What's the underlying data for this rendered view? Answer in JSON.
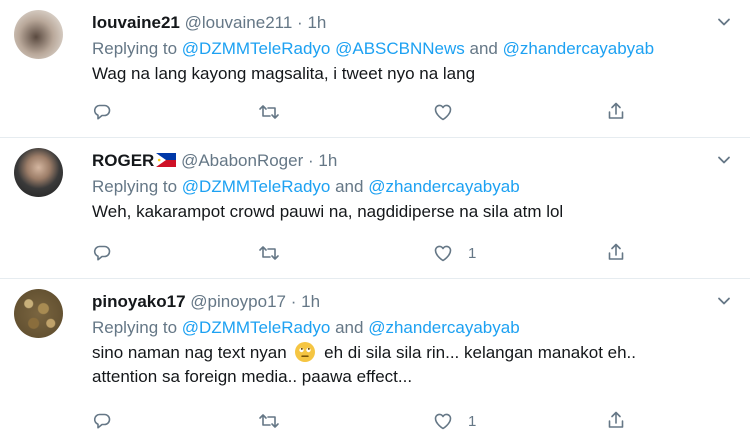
{
  "tweets": [
    {
      "name": "louvaine21",
      "handle": "@louvaine211",
      "dot": "·",
      "time": "1h",
      "replying_prefix": "Replying to ",
      "mentions": [
        "@DZMMTeleRadyo",
        "@ABSCBNNews",
        "@zhandercayabyab"
      ],
      "and": "and",
      "text_lines": [
        "Wag na lang kayong magsalita, i tweet nyo na lang"
      ],
      "like_count": ""
    },
    {
      "name": "ROGER",
      "handle": "@AbabonRoger",
      "dot": "·",
      "time": "1h",
      "replying_prefix": "Replying to ",
      "mentions": [
        "@DZMMTeleRadyo",
        "@zhandercayabyab"
      ],
      "and": "and",
      "text_lines": [
        "Weh, kakarampot crowd pauwi na, nagdidiperse na sila atm lol"
      ],
      "like_count": "1"
    },
    {
      "name": "pinoyako17",
      "handle": "@pinoypo17",
      "dot": "·",
      "time": "1h",
      "replying_prefix": "Replying to ",
      "mentions": [
        "@DZMMTeleRadyo",
        "@zhandercayabyab"
      ],
      "and": "and",
      "text_lines": [
        "sino naman nag text nyan",
        "eh di sila sila rin... kelangan manakot eh..",
        "attention sa foreign media.. paawa effect..."
      ],
      "like_count": "1"
    }
  ],
  "icons": [
    "reply-icon",
    "retweet-icon",
    "like-icon",
    "share-icon",
    "chevron-down-icon"
  ],
  "colors": {
    "link": "#1da1f2",
    "muted": "#657786",
    "text": "#14171a",
    "divider": "#e6ecf0"
  }
}
